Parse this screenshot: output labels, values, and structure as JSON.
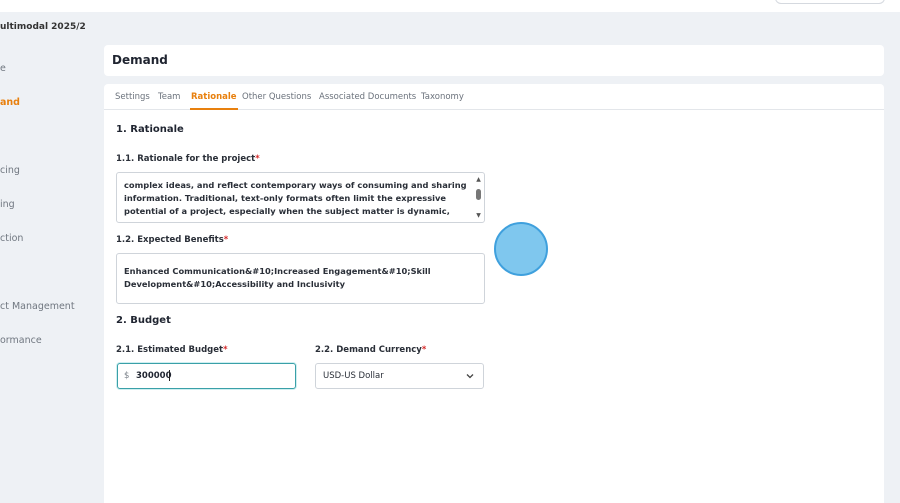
{
  "topbar": {},
  "sidebar": {
    "title": "ultimodal 2025/2",
    "items": [
      {
        "label": "e",
        "active": false
      },
      {
        "label": "and",
        "active": true
      },
      {
        "label": "cing",
        "active": false
      },
      {
        "label": "ing",
        "active": false
      },
      {
        "label": "ction",
        "active": false
      },
      {
        "label": "ct Management",
        "active": false
      },
      {
        "label": "ormance",
        "active": false
      }
    ]
  },
  "header": {
    "title": "Demand"
  },
  "tabs": [
    {
      "label": "Settings",
      "active": false
    },
    {
      "label": "Team",
      "active": false
    },
    {
      "label": "Rationale",
      "active": true
    },
    {
      "label": "Other Questions",
      "active": false
    },
    {
      "label": "Associated Documents",
      "active": false
    },
    {
      "label": "Taxonomy",
      "active": false
    }
  ],
  "rationale": {
    "section_title": "1. Rationale",
    "project_label": "1.1. Rationale for the project",
    "project_text": "complex ideas, and reflect contemporary ways of consuming and sharing\ninformation. Traditional, text-only formats often limit the expressive\npotential of a project, especially when the subject matter is dynamic,",
    "benefits_label": "1.2. Expected Benefits",
    "benefits_text": "Enhanced Communication&#10;Increased Engagement&#10;Skill\nDevelopment&#10;Accessibility and Inclusivity"
  },
  "budget": {
    "section_title": "2. Budget",
    "estimated_label": "2.1. Estimated Budget",
    "currency_symbol": "$",
    "estimated_value": "300000",
    "currency_label": "2.2. Demand Currency",
    "currency_value": "USD-US Dollar"
  },
  "required_mark": "*",
  "colors": {
    "accent": "#e8800e",
    "required": "#d62828",
    "focus": "#3aa0a8",
    "cursor": "#7fc7ee"
  }
}
